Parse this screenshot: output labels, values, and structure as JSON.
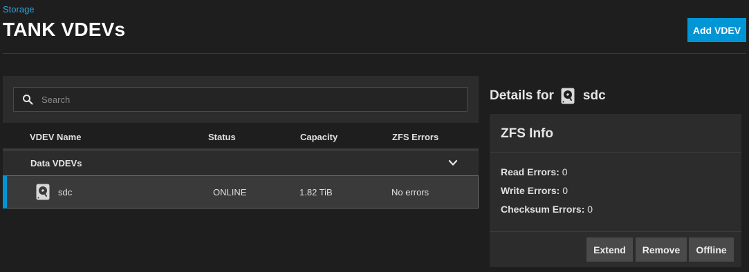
{
  "breadcrumb": "Storage",
  "page_title": "TANK VDEVs",
  "add_button": "Add VDEV",
  "search": {
    "placeholder": "Search",
    "value": "",
    "icon": "search-icon"
  },
  "table": {
    "columns": [
      "VDEV Name",
      "Status",
      "Capacity",
      "ZFS Errors"
    ],
    "group": {
      "label": "Data VDEVs",
      "expanded": true,
      "icon": "chevron-down-icon"
    },
    "rows": [
      {
        "name": "sdc",
        "status": "ONLINE",
        "capacity": "1.82 TiB",
        "errors": "No errors",
        "icon": "disk-icon",
        "selected": true
      }
    ]
  },
  "details": {
    "title_prefix": "Details for",
    "device": "sdc",
    "icon": "disk-icon",
    "zfs_info": {
      "title": "ZFS Info",
      "read_label": "Read Errors:",
      "read_value": "0",
      "write_label": "Write Errors:",
      "write_value": "0",
      "checksum_label": "Checksum Errors:",
      "checksum_value": "0"
    },
    "actions": {
      "extend": "Extend",
      "remove": "Remove",
      "offline": "Offline"
    }
  },
  "colors": {
    "accent": "#0095d5",
    "link": "#2fa3e0",
    "background": "#1e1e1e",
    "panel": "#2c2c2c"
  }
}
